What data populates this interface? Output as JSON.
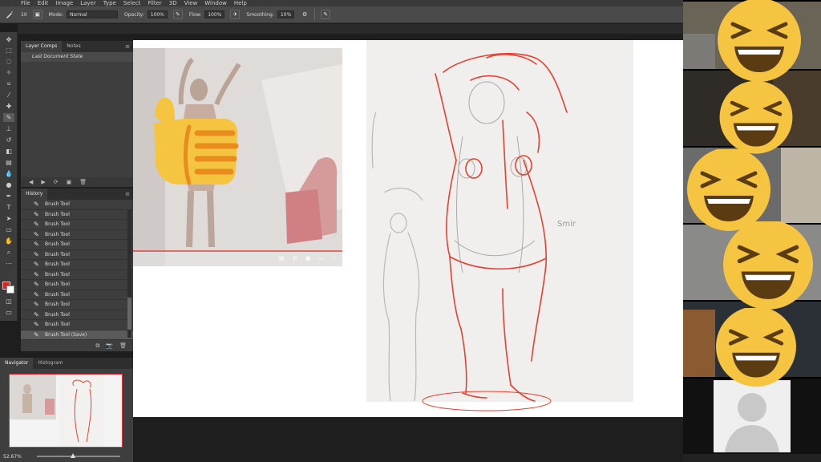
{
  "menubar": {
    "items": [
      "File",
      "Edit",
      "Image",
      "Layer",
      "Type",
      "Select",
      "Filter",
      "3D",
      "View",
      "Window",
      "Help"
    ]
  },
  "options": {
    "size": "10",
    "mode_label": "Mode:",
    "mode_value": "Normal",
    "opacity_label": "Opacity:",
    "opacity_value": "100%",
    "flow_label": "Flow:",
    "flow_value": "100%",
    "smoothing_label": "Smoothing:",
    "smoothing_value": "10%"
  },
  "layer_comps": {
    "tabs": [
      "Layer Comps",
      "Notes"
    ],
    "item": "Last Document State"
  },
  "history": {
    "title": "History",
    "items": [
      "Brush Tool",
      "Brush Tool",
      "Brush Tool",
      "Brush Tool",
      "Brush Tool",
      "Brush Tool",
      "Brush Tool",
      "Brush Tool",
      "Brush Tool",
      "Brush Tool",
      "Brush Tool",
      "Brush Tool",
      "Brush Tool",
      "Brush Tool (Save)"
    ]
  },
  "navigator": {
    "tabs": [
      "Navigator",
      "Histogram"
    ],
    "zoom": "52.67%"
  },
  "sketch": {
    "note": "Smir"
  },
  "colors": {
    "foreground": "#e0201c",
    "background": "#ffffff",
    "sketch_red": "#e8402c",
    "emoji_yellow": "#f5c542"
  }
}
